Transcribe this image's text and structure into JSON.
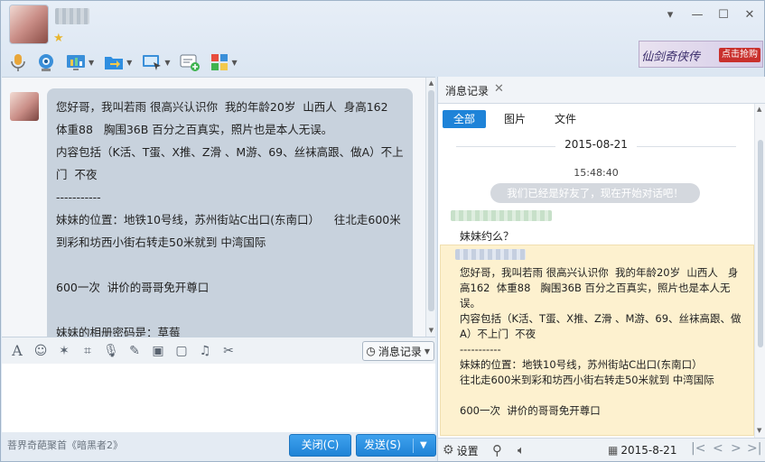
{
  "window": {
    "minimize": "—",
    "restore": "☐",
    "close": "✕",
    "menu": "▾"
  },
  "header": {
    "ad": {
      "title": "仙剑奇侠传",
      "button": "点击抢购"
    }
  },
  "toolbar": {
    "items": [
      {
        "name": "voice-icon"
      },
      {
        "name": "video-icon"
      },
      {
        "name": "screen-share-icon"
      },
      {
        "name": "send-file-icon"
      },
      {
        "name": "remote-desktop-icon"
      },
      {
        "name": "invite-icon"
      },
      {
        "name": "apps-icon"
      }
    ]
  },
  "chat": {
    "message": "您好哥，我叫若雨 很高兴认识你  我的年龄20岁  山西人  身高162  体重88   胸围36B 百分之百真实，照片也是本人无误。\n内容包括（K活、T蛋、X推、Z滑 、M游、69、丝袜高跟、做A）不上门  不夜\n-----------\n妹妹的位置：地铁10号线，苏州街站C出口(东南口）    往北走600米到彩和坊西小街右转走50米就到 中湾国际\n\n600一次  讲价的哥哥免开尊口\n\n妹妹的相册密码是：草莓"
  },
  "input_toolbar": {
    "message_record": "消息记录"
  },
  "footer": {
    "ad_text": "菩界奇葩聚首《暗黑者2》",
    "close_button": "关闭(C)",
    "send_button": "发送(S)"
  },
  "panel": {
    "tab_label": "消息记录",
    "filters": [
      "全部",
      "图片",
      "文件"
    ],
    "date": "2015-08-21",
    "time": "15:48:40",
    "system_message": "我们已经是好友了，现在开始对话吧！",
    "plain_message": "妹妹约么？",
    "highlight_message": "您好哥，我叫若雨 很高兴认识你  我的年龄20岁  山西人   身高162  体重88   胸围36B 百分之百真实，照片也是本人无误。\n内容包括（K活、T蛋、X推、Z滑 、M游、69、丝袜高跟、做A）不上门  不夜\n-----------\n妹妹的位置：地铁10号线，苏州街站C出口(东南口）\n往北走600米到彩和坊西小街右转走50米就到 中湾国际\n\n600一次  讲价的哥哥免开尊口",
    "footer": {
      "settings": "设置",
      "date": "2015-8-21"
    }
  },
  "colors": {
    "accent": "#1e83d8",
    "highlight_bg": "#fdf1cf",
    "bubble_bg": "#c8d2dd"
  }
}
